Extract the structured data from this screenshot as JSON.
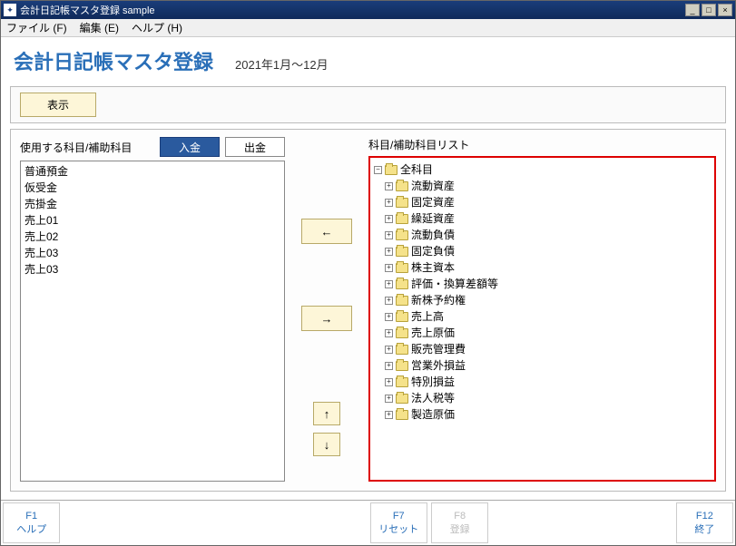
{
  "window": {
    "title": "会計日記帳マスタ登録 sample"
  },
  "menubar": {
    "file": "ファイル (F)",
    "edit": "編集 (E)",
    "help": "ヘルプ (H)"
  },
  "header": {
    "title": "会計日記帳マスタ登録",
    "period": "2021年1月～12月"
  },
  "toolbar": {
    "display": "表示"
  },
  "left": {
    "label": "使用する科目/補助科目",
    "tab_in": "入金",
    "tab_out": "出金",
    "items": [
      "普通預金",
      "仮受金",
      "売掛金",
      "売上01",
      "売上02",
      "売上03",
      "売上03"
    ]
  },
  "move": {
    "left": "←",
    "right": "→",
    "up": "↑",
    "down": "↓"
  },
  "right": {
    "label": "科目/補助科目リスト",
    "root": "全科目",
    "items": [
      "流動資産",
      "固定資産",
      "繰延資産",
      "流動負債",
      "固定負債",
      "株主資本",
      "評価・換算差額等",
      "新株予約権",
      "売上高",
      "売上原価",
      "販売管理費",
      "営業外損益",
      "特別損益",
      "法人税等",
      "製造原価"
    ]
  },
  "fkeys": {
    "f1_k": "F1",
    "f1_l": "ヘルプ",
    "f7_k": "F7",
    "f7_l": "リセット",
    "f8_k": "F8",
    "f8_l": "登録",
    "f12_k": "F12",
    "f12_l": "終了"
  }
}
